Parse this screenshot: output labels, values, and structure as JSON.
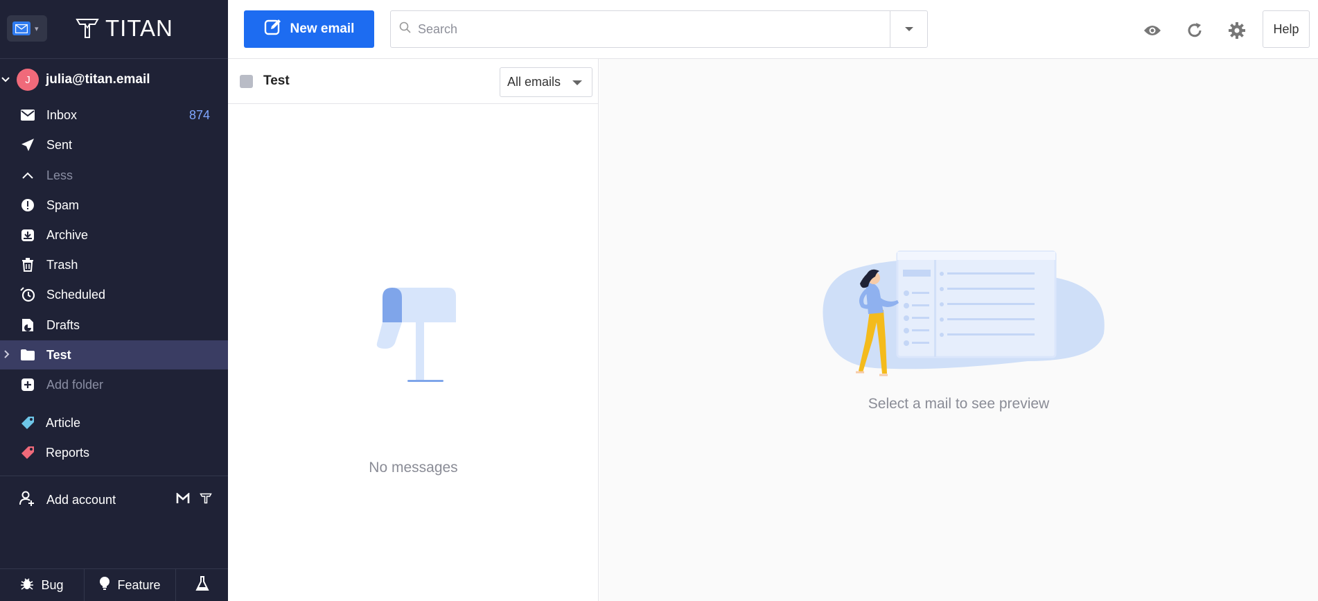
{
  "brand": {
    "name": "TITAN"
  },
  "account": {
    "avatar_initial": "J",
    "email": "julia@titan.email"
  },
  "sidebar": {
    "items": [
      {
        "label": "Inbox",
        "icon": "envelope-icon",
        "count": "874"
      },
      {
        "label": "Sent",
        "icon": "paper-plane-icon"
      },
      {
        "label": "Less",
        "icon": "chevron-up-icon"
      },
      {
        "label": "Spam",
        "icon": "alert-icon"
      },
      {
        "label": "Archive",
        "icon": "archive-icon"
      },
      {
        "label": "Trash",
        "icon": "trash-icon"
      },
      {
        "label": "Scheduled",
        "icon": "clock-icon"
      },
      {
        "label": "Drafts",
        "icon": "draft-icon"
      },
      {
        "label": "Test",
        "icon": "folder-icon"
      },
      {
        "label": "Add folder",
        "icon": "plus-icon"
      }
    ],
    "labels": [
      {
        "label": "Article",
        "color": "#6ec6e8"
      },
      {
        "label": "Reports",
        "color": "#f06a7a"
      }
    ],
    "add_account": "Add account",
    "bottom": {
      "bug": "Bug",
      "feature": "Feature"
    }
  },
  "toolbar": {
    "new_email": "New email",
    "search_placeholder": "Search",
    "help": "Help"
  },
  "list": {
    "folder_title": "Test",
    "filter": "All emails",
    "empty": "No messages"
  },
  "preview": {
    "empty": "Select a mail to see preview"
  },
  "colors": {
    "accent": "#1d6cf1",
    "sidebar_bg": "#1f2236",
    "active_bg": "#3a3d63",
    "count": "#7fa6ff"
  }
}
